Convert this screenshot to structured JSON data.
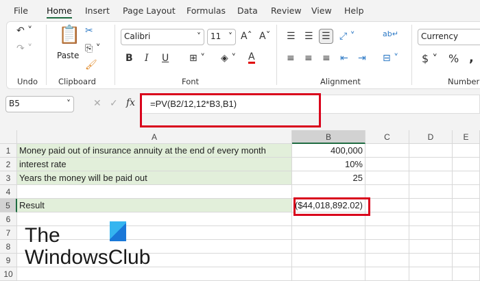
{
  "menu": {
    "tabs": [
      "File",
      "Home",
      "Insert",
      "Page Layout",
      "Formulas",
      "Data",
      "Review",
      "View",
      "Help"
    ],
    "active": "Home"
  },
  "ribbon": {
    "groups": {
      "undo": "Undo",
      "clipboard": "Clipboard",
      "font": "Font",
      "alignment": "Alignment",
      "number": "Number"
    },
    "paste_label": "Paste",
    "font_name": "Calibri",
    "font_size": "11",
    "number_format": "Currency",
    "bold": "B",
    "italic": "I",
    "underline": "U",
    "font_color_color": "#e00000"
  },
  "formula_bar": {
    "name_box": "B5",
    "fx": "fx",
    "formula": "=PV(B2/12,12*B3,B1)"
  },
  "sheet": {
    "columns": [
      "A",
      "B",
      "C",
      "D",
      "E"
    ],
    "rows": [
      {
        "n": "1",
        "a": "Money paid out of insurance annuity at the end of every month",
        "b": "400,000"
      },
      {
        "n": "2",
        "a": "interest rate",
        "b": "10%"
      },
      {
        "n": "3",
        "a": "Years the money will be paid out",
        "b": "25"
      },
      {
        "n": "4",
        "a": "",
        "b": ""
      },
      {
        "n": "5",
        "a": "Result",
        "b": "($44,018,892.02)"
      },
      {
        "n": "6",
        "a": "",
        "b": ""
      },
      {
        "n": "7",
        "a": "",
        "b": ""
      },
      {
        "n": "8",
        "a": "",
        "b": ""
      },
      {
        "n": "9",
        "a": "",
        "b": ""
      },
      {
        "n": "10",
        "a": "",
        "b": ""
      }
    ],
    "active_cell": "B5"
  },
  "watermark": {
    "line1": "The",
    "line2": "WindowsClub"
  },
  "colors": {
    "highlight": "#e2efda",
    "annotation": "#d9001b",
    "accent": "#1e6b41"
  }
}
